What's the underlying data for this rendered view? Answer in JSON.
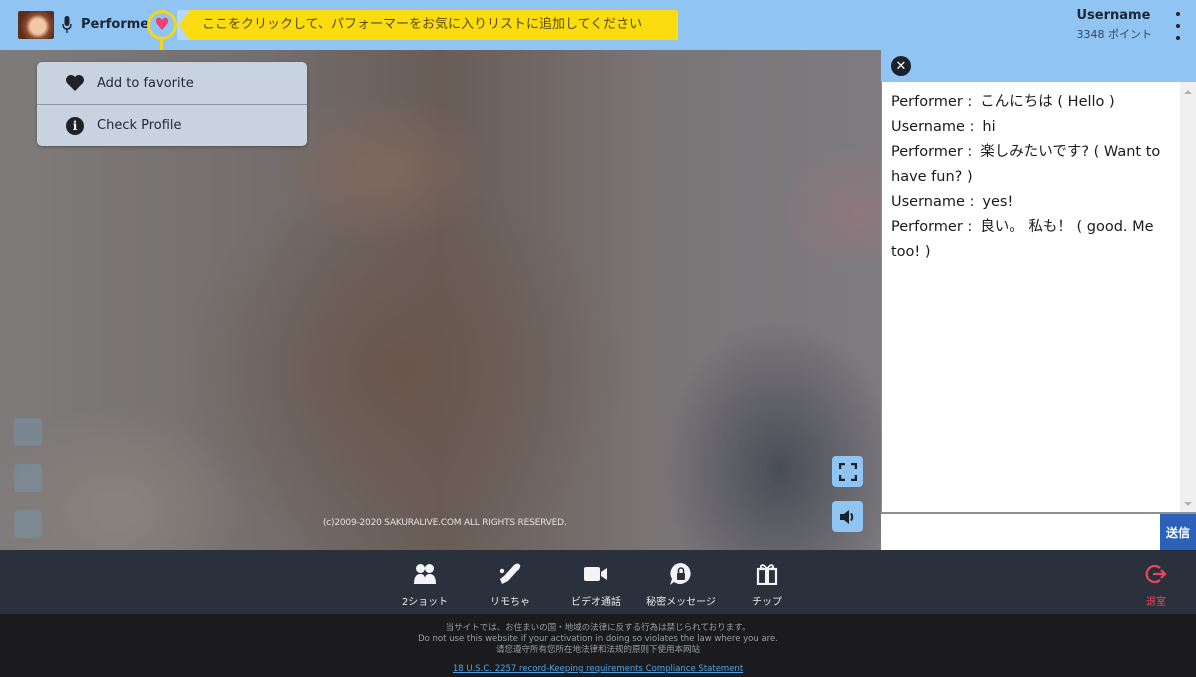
{
  "header": {
    "performer_name": "Performer",
    "favorite_tooltip": "ここをクリックして、パフォーマーをお気に入りリストに追加してください",
    "username": "Username",
    "points": "3348 ポイント"
  },
  "menu": {
    "items": [
      {
        "label": "Add to favorite",
        "icon": "heart-icon"
      },
      {
        "label": "Check Profile",
        "icon": "info-icon"
      }
    ]
  },
  "video": {
    "copyright": "(c)2009-2020 SAKURALIVE.COM ALL RIGHTS RESERVED."
  },
  "chat": {
    "messages": [
      {
        "sender": "Performer :",
        "text": "こんにちは ( Hello )"
      },
      {
        "sender": "Username :",
        "text": "hi"
      },
      {
        "sender": "Performer :",
        "text": "楽しみたいです? ( Want to have fun? )"
      },
      {
        "sender": "Username :",
        "text": "yes!"
      },
      {
        "sender": "Performer :",
        "text": "良い。 私も！ ( good. Me too! )"
      }
    ],
    "input_value": "",
    "send_label": "送信"
  },
  "actions": [
    {
      "label": "2ショット",
      "icon": "two-shot-icon"
    },
    {
      "label": "リモちゃ",
      "icon": "remote-toy-icon"
    },
    {
      "label": "ビデオ通話",
      "icon": "video-call-icon"
    },
    {
      "label": "秘密メッセージ",
      "icon": "secret-message-icon"
    },
    {
      "label": "チップ",
      "icon": "gift-icon"
    }
  ],
  "exit": {
    "label": "退室",
    "color": "#f0455d"
  },
  "footer": {
    "line1": "当サイトでは、お住まいの国・地域の法律に反する行為は禁じられております。",
    "line2": "Do not use this website if your activation in doing so violates the law where you are.",
    "line3": "请您遵守所有您所在地法律和法规的原则下使用本网站",
    "link": "18 U.S.C. 2257 record-Keeping requirements Compliance Statement"
  },
  "colors": {
    "header_bg": "#8fc4f3",
    "highlight_yellow": "#fbdc10",
    "heart_pink": "#f0406e",
    "send_blue": "#2b61b8",
    "bar_bg": "#2a303c"
  }
}
